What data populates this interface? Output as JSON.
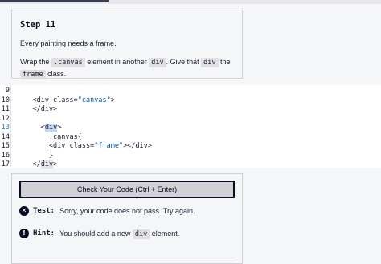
{
  "description": {
    "step_title": "Step 11",
    "intro": "Every painting needs a frame.",
    "instruction_parts": [
      "Wrap the ",
      " element in another ",
      ". Give that ",
      " the ",
      " class."
    ],
    "code_canvas": ".canvas",
    "code_div1": "div",
    "code_div2": "div",
    "code_frame": "frame"
  },
  "editor": {
    "lines": [
      {
        "num": "9",
        "text": ""
      },
      {
        "num": "10",
        "text": "    <div class=\"canvas\">"
      },
      {
        "num": "11",
        "text": "    </div>"
      },
      {
        "num": "12",
        "text": ""
      },
      {
        "num": "13",
        "text": "      <div>"
      },
      {
        "num": "14",
        "text": "        .canvas{"
      },
      {
        "num": "15",
        "text": "        <div class=\"frame\"></div>"
      },
      {
        "num": "16",
        "text": "        }"
      },
      {
        "num": "17",
        "text": "    </div>"
      }
    ]
  },
  "tests": {
    "check_button_label": "Check Your Code (Ctrl + Enter)",
    "test_label": "Test:",
    "test_message": "Sorry, your code does not pass. Try again.",
    "hint_label": "Hint:",
    "hint_parts": [
      "You should add a new ",
      " element."
    ],
    "hint_code": "div"
  }
}
